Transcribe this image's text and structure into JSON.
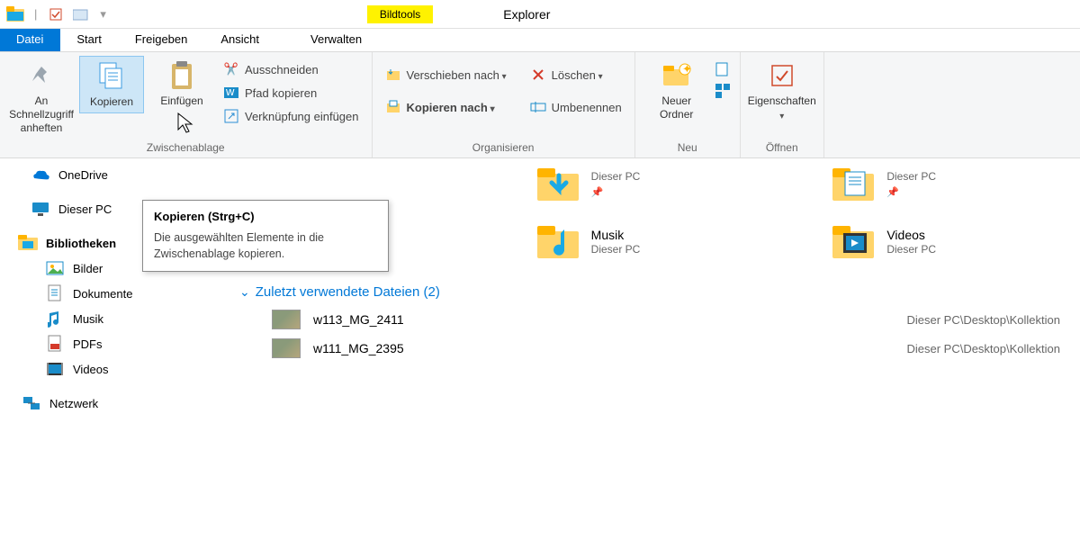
{
  "titlebar": {
    "tools_label": "Bildtools",
    "app_title": "Explorer"
  },
  "tabs": {
    "file": "Datei",
    "start": "Start",
    "share": "Freigeben",
    "view": "Ansicht",
    "manage": "Verwalten"
  },
  "ribbon": {
    "pin": {
      "l1": "An Schnellzugriff",
      "l2": "anheften"
    },
    "copy": "Kopieren",
    "paste": "Einfügen",
    "cut": "Ausschneiden",
    "copy_path": "Pfad kopieren",
    "paste_shortcut": "Verknüpfung einfügen",
    "clipboard_label": "Zwischenablage",
    "move_to": "Verschieben nach",
    "copy_to": "Kopieren nach",
    "delete": "Löschen",
    "rename": "Umbenennen",
    "organize_label": "Organisieren",
    "new_folder_l1": "Neuer",
    "new_folder_l2": "Ordner",
    "new_label": "Neu",
    "properties": "Eigenschaften",
    "open_label": "Öffnen"
  },
  "sidebar": {
    "onedrive": "OneDrive",
    "thispc": "Dieser PC",
    "libraries": "Bibliotheken",
    "pictures": "Bilder",
    "documents": "Dokumente",
    "music": "Musik",
    "pdfs": "PDFs",
    "videos": "Videos",
    "network": "Netzwerk"
  },
  "quick": {
    "loc": "Dieser PC",
    "downloads": "",
    "documents": "",
    "music": "Musik",
    "videos": "Videos"
  },
  "recent": {
    "header": "Zuletzt verwendete Dateien (2)",
    "files": [
      {
        "name": "w113_MG_2411",
        "path": "Dieser PC\\Desktop\\Kollektion"
      },
      {
        "name": "w111_MG_2395",
        "path": "Dieser PC\\Desktop\\Kollektion"
      }
    ]
  },
  "tooltip": {
    "title": "Kopieren (Strg+C)",
    "body": "Die ausgewählten Elemente in die Zwischenablage kopieren."
  }
}
